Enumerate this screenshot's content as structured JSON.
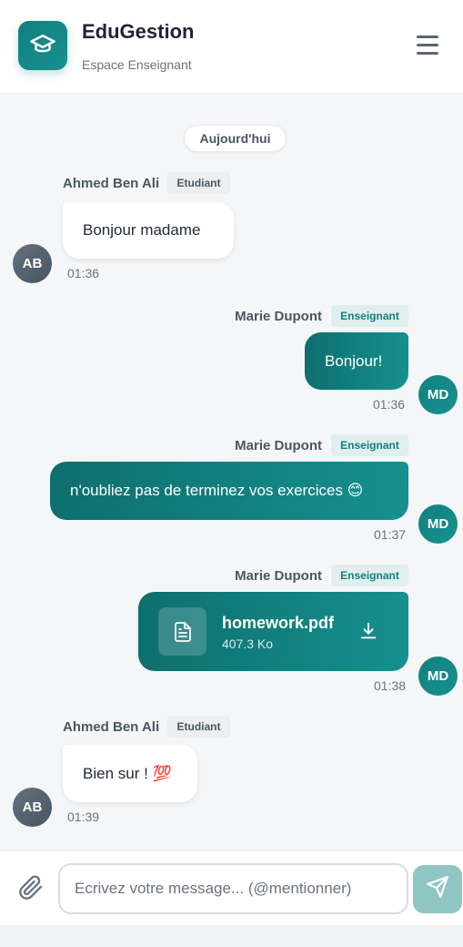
{
  "header": {
    "title": "EduGestion",
    "subtitle": "Espace Enseignant",
    "logo_icon": "graduation-cap-icon",
    "menu_icon": "hamburger-menu-icon"
  },
  "chat": {
    "date_separator": "Aujourd'hui",
    "messages": [
      {
        "sender": "Ahmed Ben Ali",
        "role": "Etudiant",
        "text": "Bonjour madame",
        "time": "01:36",
        "initials": "AB",
        "direction": "incoming"
      },
      {
        "sender": "Marie Dupont",
        "role": "Enseignant",
        "text": "Bonjour!",
        "time": "01:36",
        "initials": "MD",
        "direction": "outgoing"
      },
      {
        "sender": "Marie Dupont",
        "role": "Enseignant",
        "text": "n'oubliez pas de terminez vos exercices 😊",
        "time": "01:37",
        "initials": "MD",
        "direction": "outgoing"
      },
      {
        "sender": "Marie Dupont",
        "role": "Enseignant",
        "file_name": "homework.pdf",
        "file_size": "407.3 Ko",
        "file_icon": "document-icon",
        "action_icon": "download-icon",
        "time": "01:38",
        "initials": "MD",
        "direction": "outgoing"
      },
      {
        "sender": "Ahmed Ben Ali",
        "role": "Etudiant",
        "text": "Bien sur ! 💯",
        "time": "01:39",
        "initials": "AB",
        "direction": "incoming"
      }
    ]
  },
  "composer": {
    "placeholder": "Ecrivez votre message... (@mentionner)",
    "value": "",
    "attach_icon": "paperclip-icon",
    "send_icon": "send-icon"
  },
  "colors": {
    "brand": "#11807f",
    "brand_light": "#8fc6c4",
    "background": "#f4f6f8",
    "student_avatar": "#5a6573"
  }
}
